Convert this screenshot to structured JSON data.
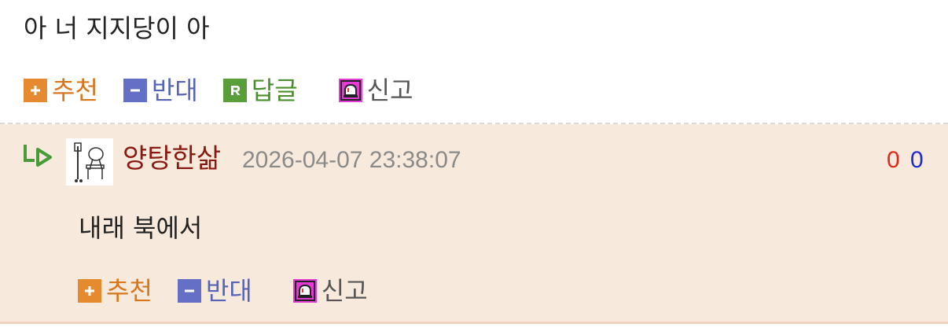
{
  "comment": {
    "text": "아 너 지지당이 아",
    "actions": {
      "recommend": "추천",
      "oppose": "반대",
      "reply": "답글",
      "report": "신고"
    }
  },
  "reply": {
    "nickname": "양탕한삶",
    "datetime": "2026-04-07 23:38:07",
    "upvotes": "0",
    "downvotes": "0",
    "text": "내래 북에서",
    "actions": {
      "recommend": "추천",
      "oppose": "반대",
      "report": "신고"
    }
  },
  "icons": {
    "recommend": "plus-icon",
    "oppose": "minus-icon",
    "reply": "reply-r-icon",
    "report": "siren-icon",
    "reply_arrow": "reply-arrow-icon"
  },
  "colors": {
    "recommend": "#d8761c",
    "oppose": "#5563b8",
    "reply": "#4a8f2a",
    "nickname": "#8a1a10",
    "upvotes": "#e0281c",
    "downvotes": "#1d2bd0",
    "reply_bg": "#f7eadc"
  }
}
